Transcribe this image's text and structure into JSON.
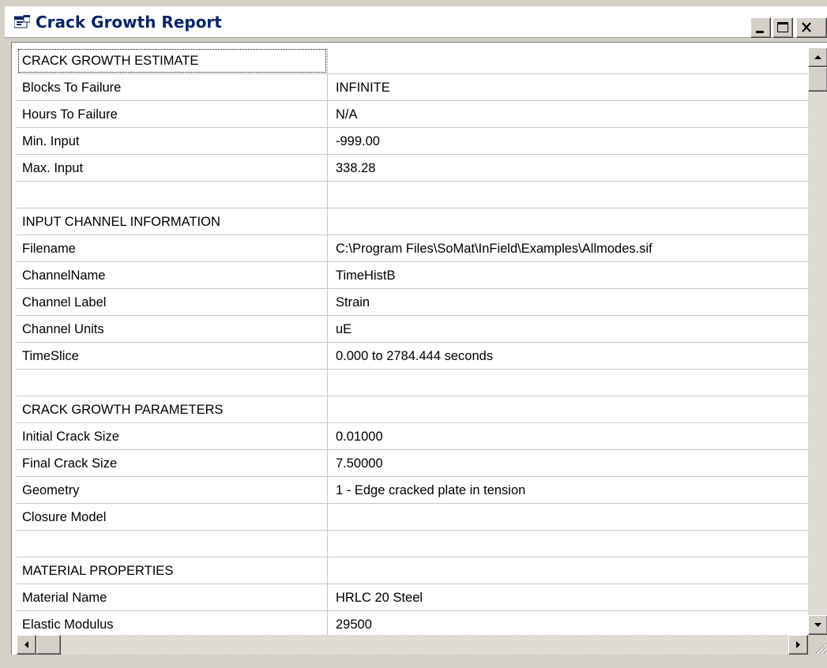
{
  "window": {
    "title": "Crack Growth Report",
    "icon": "report-window-icon"
  },
  "title_buttons": {
    "minimize": "minimize-icon",
    "maximize": "maximize-icon",
    "close": "close-icon"
  },
  "rows": [
    {
      "key": "CRACK GROWTH ESTIMATE",
      "value": ""
    },
    {
      "key": "Blocks To Failure",
      "value": "INFINITE"
    },
    {
      "key": "Hours To Failure",
      "value": "N/A"
    },
    {
      "key": "Min. Input",
      "value": "-999.00"
    },
    {
      "key": "Max. Input",
      "value": "338.28"
    },
    {
      "key": "",
      "value": ""
    },
    {
      "key": "INPUT CHANNEL INFORMATION",
      "value": ""
    },
    {
      "key": "Filename",
      "value": "C:\\Program Files\\SoMat\\InField\\Examples\\Allmodes.sif"
    },
    {
      "key": "ChannelName",
      "value": "TimeHistB"
    },
    {
      "key": "Channel Label",
      "value": "Strain"
    },
    {
      "key": "Channel Units",
      "value": "uE"
    },
    {
      "key": "TimeSlice",
      "value": "0.000 to 2784.444 seconds"
    },
    {
      "key": "",
      "value": ""
    },
    {
      "key": "CRACK GROWTH PARAMETERS",
      "value": ""
    },
    {
      "key": "Initial Crack Size",
      "value": "0.01000"
    },
    {
      "key": "Final Crack Size",
      "value": "7.50000"
    },
    {
      "key": "Geometry",
      "value": " 1 - Edge cracked plate in tension"
    },
    {
      "key": "Closure Model",
      "value": ""
    },
    {
      "key": "",
      "value": ""
    },
    {
      "key": "MATERIAL PROPERTIES",
      "value": ""
    },
    {
      "key": "Material Name",
      "value": "HRLC 20 Steel"
    },
    {
      "key": "Elastic Modulus",
      "value": "29500"
    }
  ]
}
